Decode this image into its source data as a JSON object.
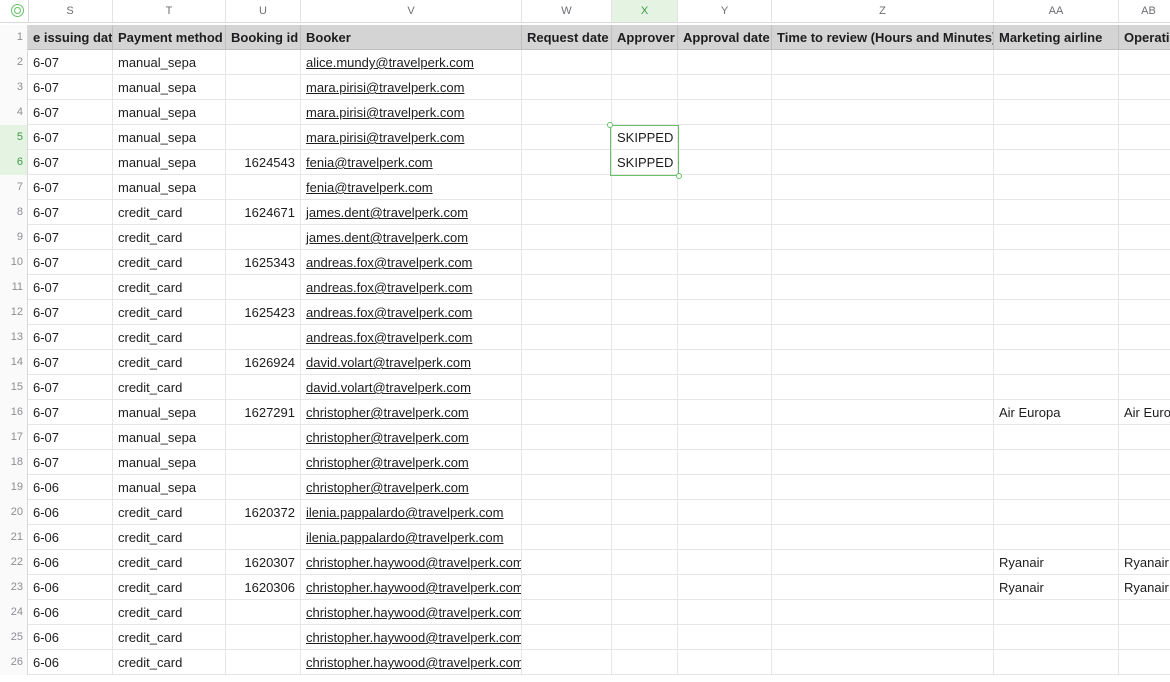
{
  "columns": [
    {
      "letter": "S",
      "header": "e issuing date"
    },
    {
      "letter": "T",
      "header": "Payment method"
    },
    {
      "letter": "U",
      "header": "Booking id"
    },
    {
      "letter": "V",
      "header": "Booker"
    },
    {
      "letter": "W",
      "header": "Request date"
    },
    {
      "letter": "X",
      "header": "Approver"
    },
    {
      "letter": "Y",
      "header": "Approval date"
    },
    {
      "letter": "Z",
      "header": "Time to review (Hours and Minutes)"
    },
    {
      "letter": "AA",
      "header": "Marketing airline"
    },
    {
      "letter": "AB",
      "header": "Operati"
    }
  ],
  "selected_column": "X",
  "header_row_number": "1",
  "rows": [
    {
      "n": "2",
      "date": "6-07",
      "payment": "manual_sepa",
      "booking": "",
      "booker": "alice.mundy@travelperk.com",
      "approver": "",
      "airline": "",
      "operating": ""
    },
    {
      "n": "3",
      "date": "6-07",
      "payment": "manual_sepa",
      "booking": "",
      "booker": "mara.pirisi@travelperk.com",
      "approver": "",
      "airline": "",
      "operating": ""
    },
    {
      "n": "4",
      "date": "6-07",
      "payment": "manual_sepa",
      "booking": "",
      "booker": "mara.pirisi@travelperk.com",
      "approver": "",
      "airline": "",
      "operating": ""
    },
    {
      "n": "5",
      "date": "6-07",
      "payment": "manual_sepa",
      "booking": "",
      "booker": "mara.pirisi@travelperk.com",
      "approver": "SKIPPED",
      "airline": "",
      "operating": ""
    },
    {
      "n": "6",
      "date": "6-07",
      "payment": "manual_sepa",
      "booking": "1624543",
      "booker": "fenia@travelperk.com",
      "approver": "SKIPPED",
      "airline": "",
      "operating": ""
    },
    {
      "n": "7",
      "date": "6-07",
      "payment": "manual_sepa",
      "booking": "",
      "booker": "fenia@travelperk.com",
      "approver": "",
      "airline": "",
      "operating": ""
    },
    {
      "n": "8",
      "date": "6-07",
      "payment": "credit_card",
      "booking": "1624671",
      "booker": "james.dent@travelperk.com",
      "approver": "",
      "airline": "",
      "operating": ""
    },
    {
      "n": "9",
      "date": "6-07",
      "payment": "credit_card",
      "booking": "",
      "booker": "james.dent@travelperk.com",
      "approver": "",
      "airline": "",
      "operating": ""
    },
    {
      "n": "10",
      "date": "6-07",
      "payment": "credit_card",
      "booking": "1625343",
      "booker": "andreas.fox@travelperk.com",
      "approver": "",
      "airline": "",
      "operating": ""
    },
    {
      "n": "11",
      "date": "6-07",
      "payment": "credit_card",
      "booking": "",
      "booker": "andreas.fox@travelperk.com",
      "approver": "",
      "airline": "",
      "operating": ""
    },
    {
      "n": "12",
      "date": "6-07",
      "payment": "credit_card",
      "booking": "1625423",
      "booker": "andreas.fox@travelperk.com",
      "approver": "",
      "airline": "",
      "operating": ""
    },
    {
      "n": "13",
      "date": "6-07",
      "payment": "credit_card",
      "booking": "",
      "booker": "andreas.fox@travelperk.com",
      "approver": "",
      "airline": "",
      "operating": ""
    },
    {
      "n": "14",
      "date": "6-07",
      "payment": "credit_card",
      "booking": "1626924",
      "booker": "david.volart@travelperk.com",
      "approver": "",
      "airline": "",
      "operating": ""
    },
    {
      "n": "15",
      "date": "6-07",
      "payment": "credit_card",
      "booking": "",
      "booker": "david.volart@travelperk.com",
      "approver": "",
      "airline": "",
      "operating": ""
    },
    {
      "n": "16",
      "date": "6-07",
      "payment": "manual_sepa",
      "booking": "1627291",
      "booker": "christopher@travelperk.com",
      "approver": "",
      "airline": "Air Europa",
      "operating": "Air Euro"
    },
    {
      "n": "17",
      "date": "6-07",
      "payment": "manual_sepa",
      "booking": "",
      "booker": "christopher@travelperk.com",
      "approver": "",
      "airline": "",
      "operating": ""
    },
    {
      "n": "18",
      "date": "6-07",
      "payment": "manual_sepa",
      "booking": "",
      "booker": "christopher@travelperk.com",
      "approver": "",
      "airline": "",
      "operating": ""
    },
    {
      "n": "19",
      "date": "6-06",
      "payment": "manual_sepa",
      "booking": "",
      "booker": "christopher@travelperk.com",
      "approver": "",
      "airline": "",
      "operating": ""
    },
    {
      "n": "20",
      "date": "6-06",
      "payment": "credit_card",
      "booking": "1620372",
      "booker": "ilenia.pappalardo@travelperk.com",
      "approver": "",
      "airline": "",
      "operating": ""
    },
    {
      "n": "21",
      "date": "6-06",
      "payment": "credit_card",
      "booking": "",
      "booker": "ilenia.pappalardo@travelperk.com",
      "approver": "",
      "airline": "",
      "operating": ""
    },
    {
      "n": "22",
      "date": "6-06",
      "payment": "credit_card",
      "booking": "1620307",
      "booker": "christopher.haywood@travelperk.com",
      "approver": "",
      "airline": "Ryanair",
      "operating": "Ryanair"
    },
    {
      "n": "23",
      "date": "6-06",
      "payment": "credit_card",
      "booking": "1620306",
      "booker": "christopher.haywood@travelperk.com",
      "approver": "",
      "airline": "Ryanair",
      "operating": "Ryanair"
    },
    {
      "n": "24",
      "date": "6-06",
      "payment": "credit_card",
      "booking": "",
      "booker": "christopher.haywood@travelperk.com",
      "approver": "",
      "airline": "",
      "operating": ""
    },
    {
      "n": "25",
      "date": "6-06",
      "payment": "credit_card",
      "booking": "",
      "booker": "christopher.haywood@travelperk.com",
      "approver": "",
      "airline": "",
      "operating": ""
    },
    {
      "n": "26",
      "date": "6-06",
      "payment": "credit_card",
      "booking": "",
      "booker": "christopher.haywood@travelperk.com",
      "approver": "",
      "airline": "",
      "operating": ""
    }
  ],
  "colors": {
    "selection": "#67c16b",
    "header_bg": "#d4d4d4",
    "selected_col_bg": "#e5f3e3"
  }
}
